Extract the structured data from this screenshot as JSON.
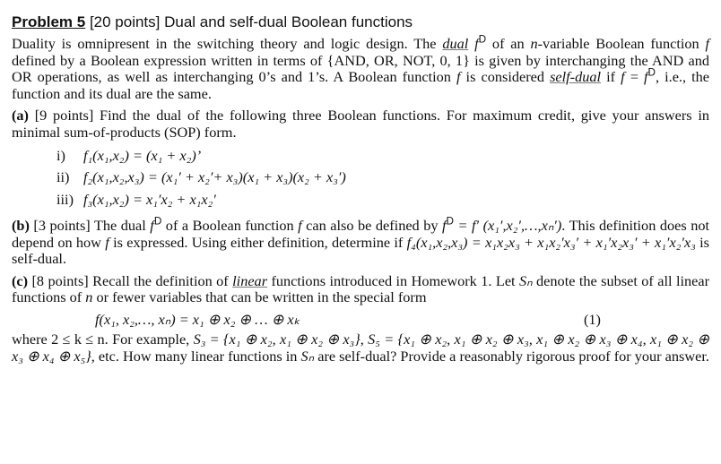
{
  "problem": {
    "number_label": "Problem 5",
    "points": "[20 points]",
    "title": "Dual and self-dual Boolean functions"
  },
  "intro": {
    "t1": "Duality is omnipresent in the switching theory and logic design. The ",
    "dual_term": "dual",
    "t2": " of an ",
    "n_var": "n",
    "t3": "-variable Boolean function ",
    "t4": " defined by a Boolean expression written in terms of {AND, OR, NOT, 0, 1} is given by interchanging the AND and OR operations, as well as interchanging 0’s and 1’s. A Boolean function ",
    "t5": " is considered ",
    "self_dual_term": "self-dual",
    "t6": " if ",
    "t7": ", i.e., the function and its dual are the same."
  },
  "symbols": {
    "f": "f",
    "D": "D",
    "eq": " = "
  },
  "part_a": {
    "label": "(a)",
    "points": "[9 points]",
    "text": " Find the dual of the following three Boolean functions. For maximum credit, give your answers in minimal sum-of-products (SOP) form.",
    "items": [
      {
        "label": "i)",
        "expr": "f₁(x₁,x₂) = (x₁ + x₂)’"
      },
      {
        "label": "ii)",
        "expr": "f₂(x₁,x₂,x₃) = (x₁′ + x₂′+ x₃)(x₁ + x₃)(x₂ + x₃′)"
      },
      {
        "label": "iii)",
        "expr": "f₃(x₁,x₂) = x₁′x₂ + x₁x₂′"
      }
    ]
  },
  "part_b": {
    "label": "(b)",
    "points": "[3 points]",
    "t1": " The dual ",
    "t2": " of a Boolean function ",
    "t3": " can also be defined by ",
    "def_expr": " = f′ (x₁′,x₂′,…,xₙ′)",
    "t4": ". This definition does not depend on how ",
    "t5": " is expressed. Using either definition, determine if ",
    "f4_expr": "f₄(x₁,x₂,x₃) = x₁x₂x₃ + x₁x₂′x₃′ + x₁′x₂x₃′ + x₁′x₂′x₃",
    "t6": " is self-dual."
  },
  "part_c": {
    "label": "(c)",
    "points": "[8 points]",
    "t1": " Recall the definition of ",
    "linear_term": "linear",
    "t2": " functions introduced in Homework 1. Let ",
    "Sn": "Sₙ",
    "t3": " denote the subset of all linear functions of ",
    "n": "n",
    "t4": " or fewer variables that can be written in the special form",
    "equation": "f(x₁, x₂,…, xₙ) = x₁ ⊕ x₂ ⊕ … ⊕ xₖ",
    "equation_number": "(1)",
    "t5": "where 2 ≤ k ≤ n. For example, ",
    "S3": "S₃ = {x₁ ⊕ x₂, x₁ ⊕ x₂ ⊕ x₃}",
    "sep": ", ",
    "S5": "S₅ = {x₁ ⊕ x₂, x₁ ⊕ x₂ ⊕ x₃, x₁ ⊕ x₂ ⊕ x₃ ⊕ x₄, x₁ ⊕ x₂ ⊕ x₃ ⊕ x₄ ⊕ x₅}",
    "t6": ", etc. How many linear functions in ",
    "t7": " are self-dual? Provide a reasonably rigorous proof for your answer."
  }
}
